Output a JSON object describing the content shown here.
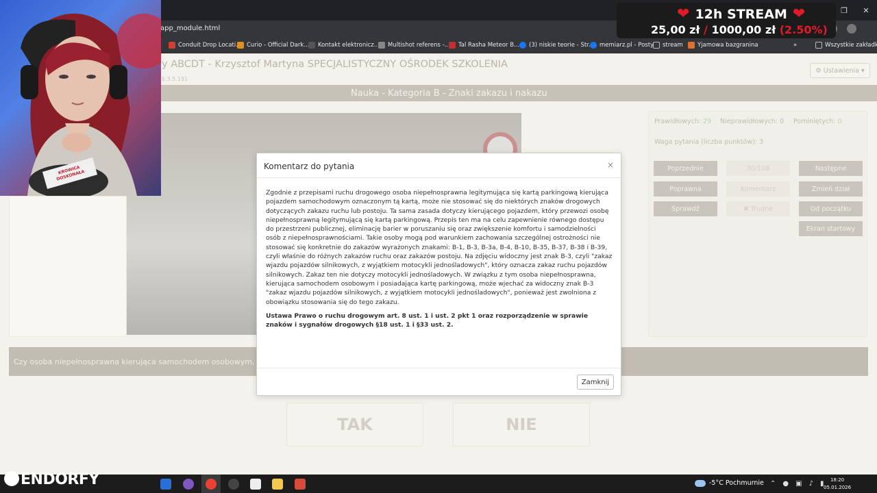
{
  "browser": {
    "url": "app_module.html",
    "bookmarks": [
      {
        "label": "Conduit Drop Locati...",
        "color": "#d04030"
      },
      {
        "label": "Curio - Official Dark...",
        "color": "#e09020"
      },
      {
        "label": "Kontakt elektronicz...",
        "color": "#555555"
      },
      {
        "label": "Multishot referens -...",
        "color": "#888888"
      },
      {
        "label": "Tal Rasha Meteor B...",
        "color": "#c03030"
      },
      {
        "label": "(3) niskie teorie - Str...",
        "color": "#1877f2"
      },
      {
        "label": "memiarz.pl - Posty",
        "color": "#1877f2"
      },
      {
        "label": "stream",
        "color": "#bbbbbb"
      },
      {
        "label": "Yjamowa bazgranina",
        "color": "#e07030"
      },
      {
        "label": "»",
        "color": ""
      },
      {
        "label": "Wszystkie zakładki",
        "color": "#bbbbbb"
      }
    ]
  },
  "stream": {
    "title": "12h STREAM",
    "current": "25,00 zł",
    "separator": "/",
    "goal": "1000,00 zł",
    "percent": "(2.50%)"
  },
  "header": {
    "title": "y ABCDT - Krzysztof Martyna SPECJALISTYCZNY OŚRODEK SZKOLENIA",
    "version": "6.3.5.191",
    "settings_label": "⚙ Ustawienia ▾"
  },
  "nav": {
    "banner": "Nauka - Kategoria B - Znaki zakazu i nakazu"
  },
  "stats": {
    "correct_label": "Prawidłowych:",
    "correct_value": "29",
    "incorrect_label": "Nieprawidłowych:",
    "incorrect_value": "0",
    "skipped_label": "Pominiętych:",
    "skipped_value": "0",
    "weight": "Waga pytania (liczba punktów): 3"
  },
  "controls": {
    "previous": "Poprzednie",
    "counter": "30/108",
    "next": "Następne",
    "correct": "Poprawna",
    "comment": "Komentarz",
    "change_section": "Zmień dział",
    "check": "Sprawdź",
    "difficult": "✖ Trudne",
    "from_start": "Od początku",
    "start_screen": "Ekran startowy"
  },
  "question": {
    "text": "Czy osoba niepełnosprawna kierująca samochodem osobowym, leg",
    "yes": "TAK",
    "no": "NIE"
  },
  "modal": {
    "title": "Komentarz do pytania",
    "close_x": "×",
    "body": "Zgodnie z przepisami ruchu drogowego osoba niepełnosprawna legitymująca się kartą parkingową kierująca pojazdem samochodowym oznaczonym tą kartą, może nie stosować się do niektórych znaków drogowych dotyczących zakazu ruchu lub postoju. Ta sama zasada dotyczy kierującego pojazdem, który przewozi osobę niepełnosprawną legitymującą się kartą parkingową. Przepis ten ma na celu zapewnienie równego dostępu do przestrzeni publicznej, eliminację barier w poruszaniu się oraz zwiększenie komfortu i samodzielności osób z niepełnosprawnościami. Takie osoby mogą pod warunkiem zachowania szczególnej ostrożności nie stosować się konkretnie do zakazów wyrażonych znakami: B-1, B-3, B-3a, B-4, B-10, B-35, B-37, B-38 i B-39, czyli właśnie do różnych zakazów ruchu oraz zakazów postoju. Na zdjęciu widoczny jest znak B-3, czyli \"zakaz wjazdu pojazdów silnikowych, z wyjątkiem motocykli jednośladowych\", który oznacza zakaz ruchu pojazdów silnikowych. Zakaz ten nie dotyczy motocykli jednośladowych. W związku z tym osoba niepełnosprawna, kierująca samochodem osobowym i posiadająca kartę parkingową, może wjechać za widoczny znak B-3 \"zakaz wjazdu pojazdów silnikowych, z wyjątkiem motocykli jednośladowych\", ponieważ jest zwolniona z obowiązku stosowania się do tego zakazu.",
    "legal": "Ustawa Prawo o ruchu drogowym art. 8 ust. 1 i ust. 2 pkt 1 oraz rozporządzenie w sprawie znaków i sygnałów drogowych §18 ust. 1 i §33 ust. 2.",
    "close_button": "Zamknij"
  },
  "webcam": {
    "mic_label": "KROWICA DOSKONAŁA"
  },
  "taskbar": {
    "brand": "ENDORFY",
    "weather": "-5°C Pochmurnie",
    "time": "18:20",
    "date": "05.01.2026"
  }
}
